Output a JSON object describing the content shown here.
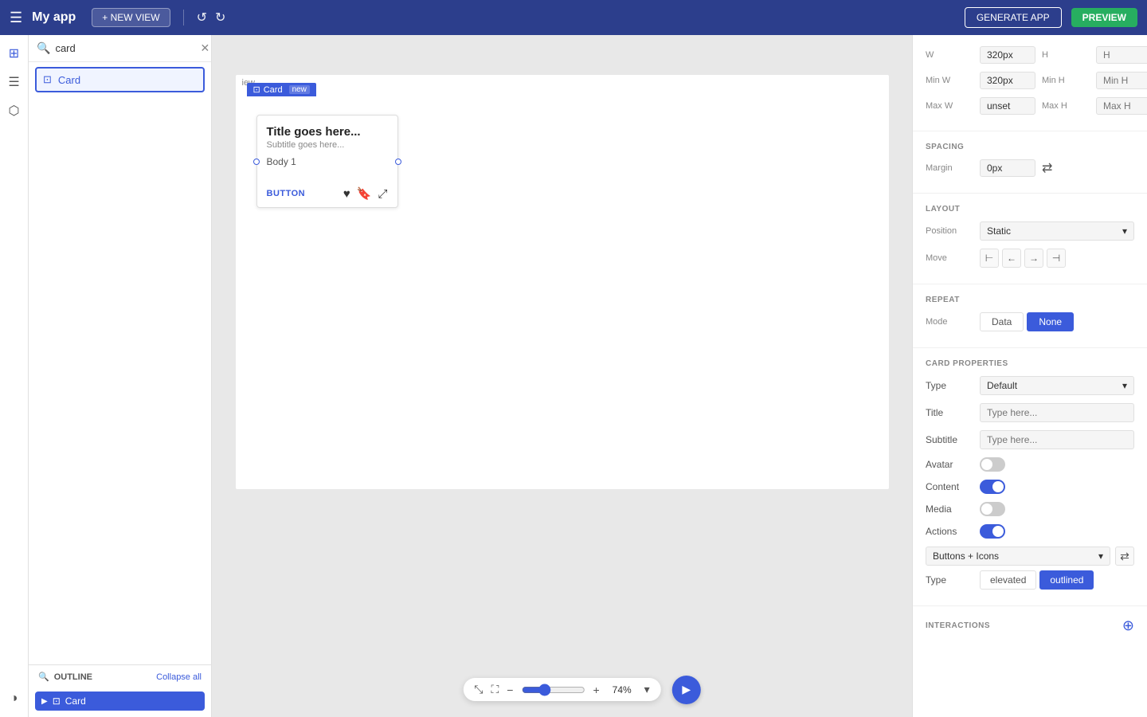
{
  "topNav": {
    "menuIcon": "☰",
    "appTitle": "My app",
    "newViewLabel": "+ NEW VIEW",
    "undoIcon": "↺",
    "redoIcon": "↻",
    "generateLabel": "GENERATE APP",
    "previewLabel": "PREVIEW"
  },
  "leftSidebar": {
    "icons": [
      {
        "name": "components-icon",
        "glyph": "⊞"
      },
      {
        "name": "layers-icon",
        "glyph": "☰"
      },
      {
        "name": "data-icon",
        "glyph": "⬡"
      },
      {
        "name": "theme-icon",
        "glyph": "◑"
      }
    ]
  },
  "componentPanel": {
    "searchPlaceholder": "card",
    "searchValue": "card",
    "clearIcon": "✕",
    "componentItem": {
      "icon": "⊡",
      "label": "Card"
    }
  },
  "outline": {
    "title": "OUTLINE",
    "collapseAll": "Collapse all",
    "items": [
      {
        "label": "Card",
        "icon": "⊡",
        "expanded": true
      }
    ]
  },
  "canvas": {
    "cardLabel": "Card",
    "newBadge": "new",
    "card": {
      "title": "Title goes here...",
      "subtitle": "Subtitle goes here...",
      "body": "Body 1",
      "buttonLabel": "BUTTON"
    },
    "zoomMinus": "−",
    "zoomPlus": "+",
    "zoomLevel": "74%",
    "zoomDropdown": "▾",
    "playIcon": "▶"
  },
  "rightPanel": {
    "dimensions": {
      "wLabel": "W",
      "hLabel": "H",
      "wValue": "320px",
      "hValue": "",
      "minWLabel": "Min W",
      "minHLabel": "Min H",
      "minWValue": "320px",
      "minHValue": "",
      "maxWLabel": "Max W",
      "maxHLabel": "Max H",
      "maxWValue": "unset",
      "maxHValue": ""
    },
    "spacing": {
      "title": "SPACING",
      "marginLabel": "Margin",
      "marginValue": "0px",
      "syncIcon": "⇄"
    },
    "layout": {
      "title": "LAYOUT",
      "positionLabel": "Position",
      "positionValue": "Static",
      "moveLabel": "Move",
      "moveIcons": [
        "⊢",
        "←",
        "→",
        "⊣"
      ]
    },
    "repeat": {
      "title": "REPEAT",
      "modeLabel": "Mode",
      "modes": [
        "Data",
        "None"
      ],
      "activeMode": "None"
    },
    "cardProperties": {
      "title": "CARD PROPERTIES",
      "typeLabel": "Type",
      "typeValue": "Default",
      "titleLabel": "Title",
      "titlePlaceholder": "Type here...",
      "subtitleLabel": "Subtitle",
      "subtitlePlaceholder": "Type here...",
      "avatarLabel": "Avatar",
      "avatarOn": false,
      "contentLabel": "Content",
      "contentOn": true,
      "mediaLabel": "Media",
      "mediaOn": false,
      "actionsLabel": "Actions",
      "actionsOn": true,
      "actionsDropdown": "Buttons + Icons",
      "cardTypeLabel": "Type",
      "cardTypes": [
        "elevated",
        "outlined"
      ],
      "activeCardType": "outlined"
    },
    "interactions": {
      "title": "INTERACTIONS",
      "addIcon": "⊕"
    }
  }
}
